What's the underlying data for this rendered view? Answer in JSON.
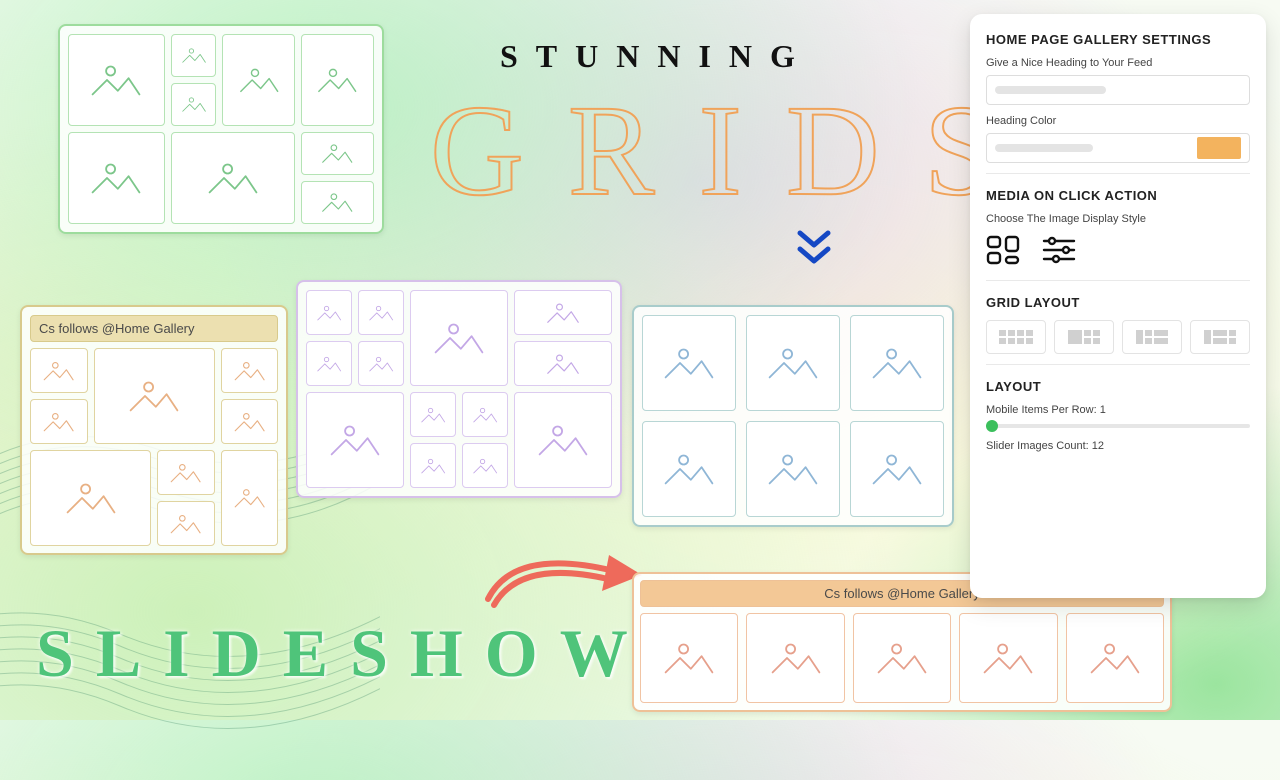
{
  "headline": {
    "stunning": "STUNNING",
    "grids": "GRIDS",
    "slideshow": "SLIDESHOW"
  },
  "cards": {
    "olive_header": "Cs follows @Home Gallery",
    "slideshow_header": "Cs follows @Home Gallery"
  },
  "colors": {
    "grids_outline": "#f0a35a",
    "slideshow_text": "#4fc47a",
    "chevron": "#1548c4",
    "arrow": "#ee6a5b",
    "swatch": "#f3b35e",
    "slider_dot": "#3bbf5c"
  },
  "panel": {
    "title": "HOME PAGE GALLERY SETTINGS",
    "heading_label": "Give a Nice Heading to Your Feed",
    "heading_color_label": "Heading Color",
    "media_click_title": "MEDIA ON CLICK ACTION",
    "media_click_sub": "Choose The Image Display Style",
    "grid_layout_title": "GRID LAYOUT",
    "layout_title": "LAYOUT",
    "mobile_items_label": "Mobile Items Per Row: 1",
    "slider_count_label": "Slider Images Count: 12"
  }
}
